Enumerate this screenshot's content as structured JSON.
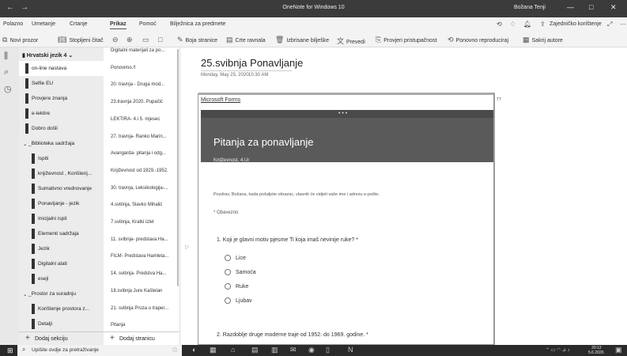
{
  "window": {
    "title": "OneNote for Windows 10",
    "user": "Božana Tenji",
    "back": "←",
    "forward": "→",
    "minimize": "—",
    "maximize": "□",
    "close": "✕"
  },
  "menu": {
    "items": [
      "Polazno",
      "Umetanje",
      "Crtanje",
      "Prikaz",
      "Pomoć",
      "Bilježnica za predmete"
    ],
    "active": "Prikaz",
    "share_label": "Zajedničko korištenje"
  },
  "toolbar": {
    "items": [
      {
        "label": "Novi prozor",
        "icon": "new-window-icon"
      },
      {
        "label": "Stopljeni čitač",
        "icon": "immersive-reader-icon"
      },
      {
        "label": "",
        "icon": "zoom-out-icon"
      },
      {
        "label": "",
        "icon": "zoom-in-icon"
      },
      {
        "label": "",
        "icon": "page-width-icon"
      },
      {
        "label": "",
        "icon": "full-page-icon"
      },
      {
        "label": "Boja stranice",
        "icon": "page-color-icon"
      },
      {
        "label": "Crte ravnala",
        "icon": "rule-lines-icon"
      },
      {
        "label": "Izbrisane bilješke",
        "icon": "deleted-notes-icon"
      },
      {
        "label": "Prevedi",
        "icon": "translate-icon"
      },
      {
        "label": "Provjeri pristupačnost",
        "icon": "accessibility-icon"
      },
      {
        "label": "Ponovno reproduciraj",
        "icon": "replay-icon"
      },
      {
        "label": "Sakrij autore",
        "icon": "hide-authors-icon"
      }
    ]
  },
  "notebook": {
    "name": "Hrvatski jezik 4",
    "sections": [
      {
        "label": "on-line nastava",
        "selected": true
      },
      {
        "label": "Selfie EU"
      },
      {
        "label": "Provjere znanja"
      },
      {
        "label": "e-lektire"
      },
      {
        "label": "Dobro došli"
      },
      {
        "label": "_Biblioteka sadržaja",
        "group": true
      },
      {
        "label": "Ispiti"
      },
      {
        "label": "književnost , Korištenj..."
      },
      {
        "label": "Sumativno vrednovanje"
      },
      {
        "label": "Ponavljanje - jezik"
      },
      {
        "label": "Inicijalni ispit"
      },
      {
        "label": "Elementi sadržaja"
      },
      {
        "label": "Jezik"
      },
      {
        "label": "Digitalni alati"
      },
      {
        "label": "eseji"
      },
      {
        "label": "_Prostor za suradnju",
        "group": true
      },
      {
        "label": "Korištenje prostora z..."
      },
      {
        "label": "Detalji"
      }
    ],
    "add_section": "Dodaj sekciju"
  },
  "pages": {
    "items": [
      {
        "label": "Digitalni materijali za po..."
      },
      {
        "label": "Ponovimo.!!"
      },
      {
        "label": "20. travnja - Druga mod..."
      },
      {
        "label": "23.travnja 2020. Pupačić"
      },
      {
        "label": "LEKTIRA- 4.i 5. mjesec"
      },
      {
        "label": "27. travnja- Ranko Marin..."
      },
      {
        "label": "Avangarda- pitanja i odg..."
      },
      {
        "label": "Književnost od 1929.-1952."
      },
      {
        "label": "30. travnja, Leksikologija-..."
      },
      {
        "label": "4.svibnja, Slavko Mihalić"
      },
      {
        "label": "7.svibnja, Kratki izlet"
      },
      {
        "label": "11. svibnja- predstava Ha..."
      },
      {
        "label": "FILM- Predstava Hamleta..."
      },
      {
        "label": "14. svibnja- Predstva Ha..."
      },
      {
        "label": "18.svibnja Jure Kaštelan"
      },
      {
        "label": "21. svibnja Proza u traper..."
      },
      {
        "label": "Pitanja"
      },
      {
        "label": "25.svibnja Ponavljanje",
        "selected": true
      }
    ],
    "add_page": "Dodaj stranicu"
  },
  "page": {
    "title": "25.svibnja Ponavljanje",
    "date": "Monday, May 25, 2020",
    "time": "10:30 AM",
    "link": "Microsoft Forms",
    "tt": "TT",
    "form": {
      "title": "Pitanja za ponavljanje",
      "subtitle": "Književnost, 4.Ur",
      "greeting": "Pozdrav, Božana, kada pošaljete obrazac, vlasnik će vidjeti vaše ime i adresu e-pošte.",
      "required": "* Obavezno",
      "question1": "1. Koji je glavni motiv pjesme Ti koja imaš nevinije ruke? *",
      "options": [
        "Lice",
        "Samoća",
        "Ruke",
        "Ljubav"
      ],
      "question2": "2. Razdoblje druge moderne traje od 1952. do 1969. godine. *"
    }
  },
  "taskbar": {
    "search_placeholder": "Upišite ovdje za pretraživanje",
    "time": "20:12",
    "date": "5.6.2020."
  }
}
